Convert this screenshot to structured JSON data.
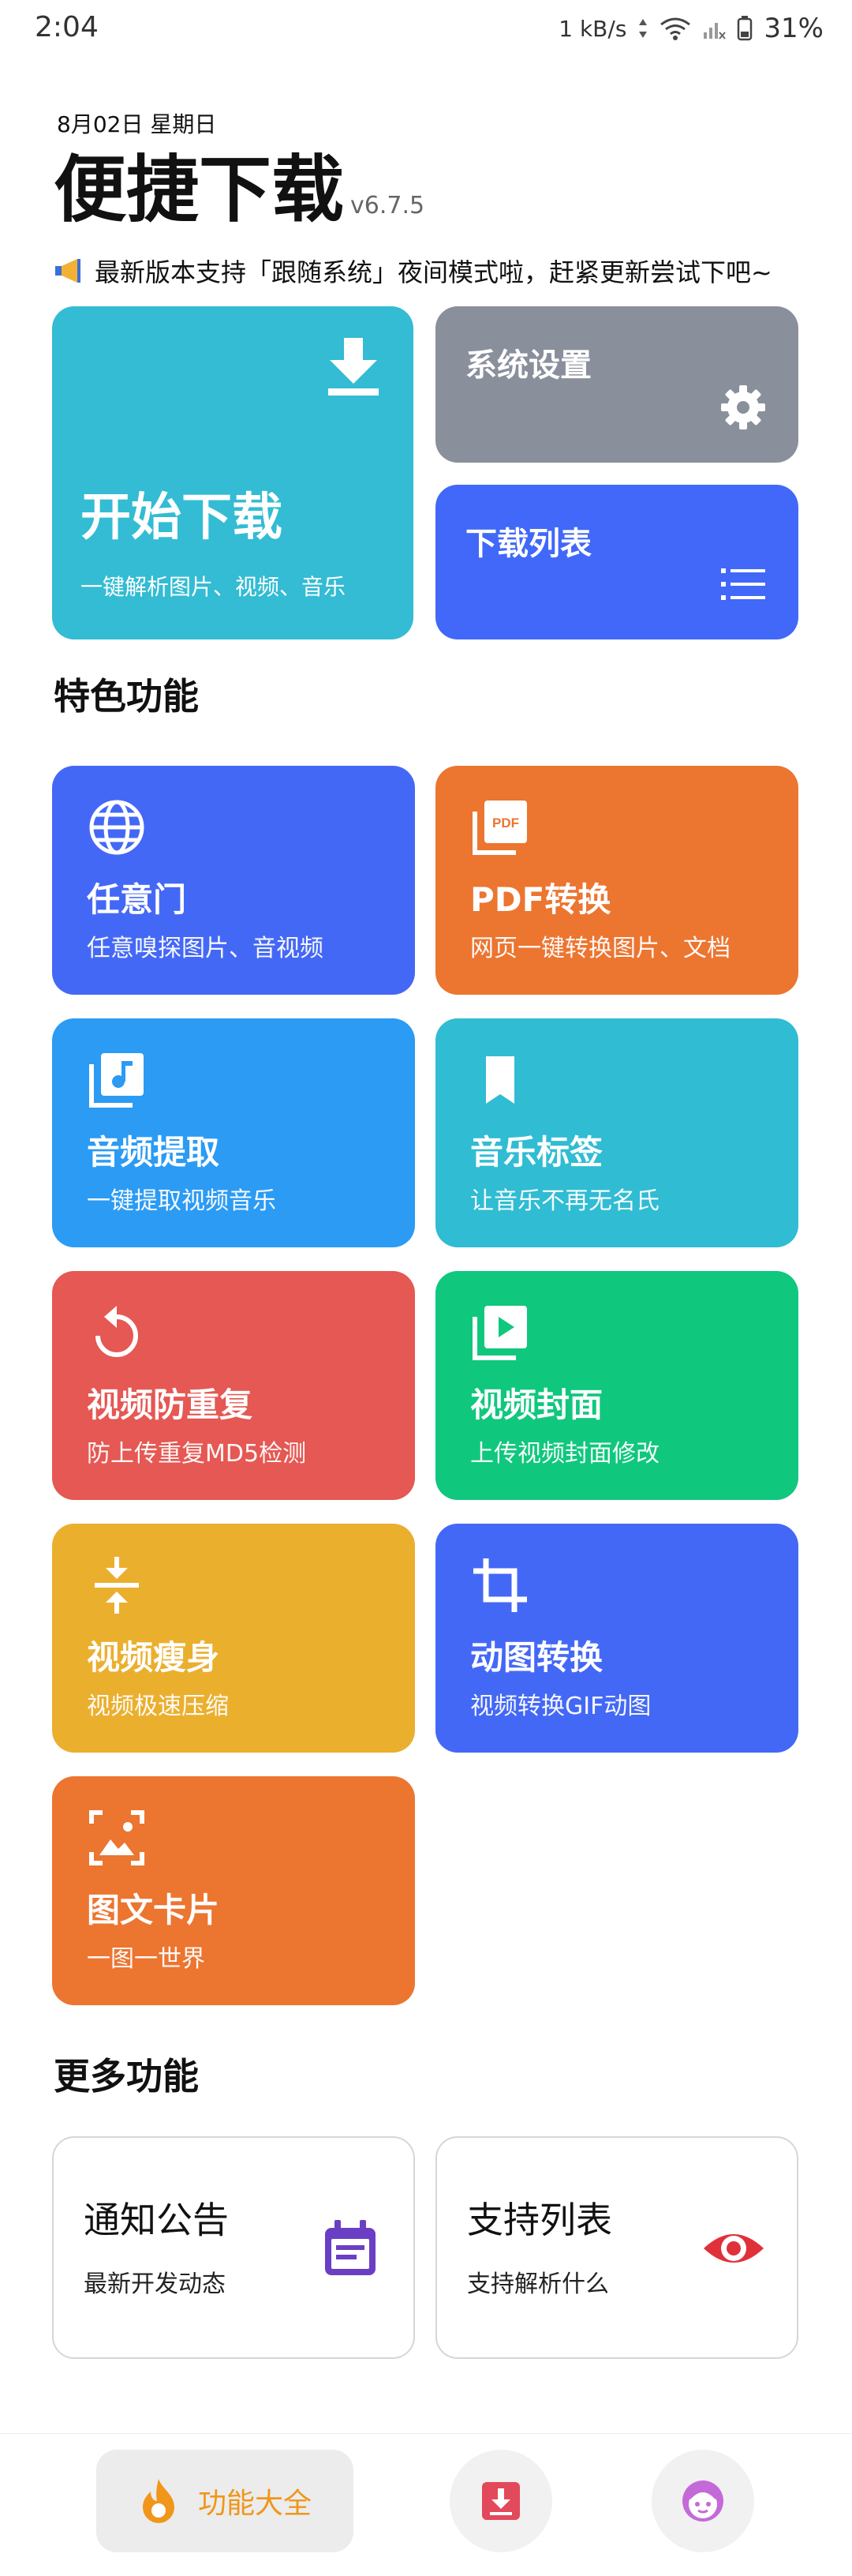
{
  "status_bar": {
    "time": "2:04",
    "speed": "1 kB/s",
    "battery": "31%"
  },
  "header": {
    "date": "8月02日 星期日",
    "title": "便捷下载",
    "version": "v6.7.5",
    "notice": "最新版本支持「跟随系统」夜间模式啦，赶紧更新尝试下吧~"
  },
  "main_tiles": {
    "start": {
      "title": "开始下载",
      "subtitle": "一键解析图片、视频、音乐",
      "icon": "download-icon"
    },
    "settings": {
      "title": "系统设置",
      "icon": "gear-icon"
    },
    "list": {
      "title": "下载列表",
      "icon": "list-icon"
    }
  },
  "features": {
    "section_title": "特色功能",
    "items": [
      {
        "title": "任意门",
        "subtitle": "任意嗅探图片、音视频",
        "icon": "globe-icon",
        "color": "#4468F6"
      },
      {
        "title": "PDF转换",
        "subtitle": "网页一键转换图片、文档",
        "icon": "pdf-icon",
        "color": "#EC7530"
      },
      {
        "title": "音频提取",
        "subtitle": "一键提取视频音乐",
        "icon": "music-library-icon",
        "color": "#2B9BF4"
      },
      {
        "title": "音乐标签",
        "subtitle": "让音乐不再无名氏",
        "icon": "bookmark-icon",
        "color": "#30BCD3"
      },
      {
        "title": "视频防重复",
        "subtitle": "防上传重复MD5检测",
        "icon": "replay-icon",
        "color": "#E55853"
      },
      {
        "title": "视频封面",
        "subtitle": "上传视频封面修改",
        "icon": "video-library-icon",
        "color": "#10C77E"
      },
      {
        "title": "视频瘦身",
        "subtitle": "视频极速压缩",
        "icon": "compress-icon",
        "color": "#EBAF2E"
      },
      {
        "title": "动图转换",
        "subtitle": "视频转换GIF动图",
        "icon": "crop-icon",
        "color": "#4468F6"
      },
      {
        "title": "图文卡片",
        "subtitle": "一图一世界",
        "icon": "image-card-icon",
        "color": "#EC7530"
      }
    ]
  },
  "more": {
    "section_title": "更多功能",
    "items": [
      {
        "title": "通知公告",
        "subtitle": "最新开发动态",
        "icon": "calendar-note-icon"
      },
      {
        "title": "支持列表",
        "subtitle": "支持解析什么",
        "icon": "eye-icon"
      }
    ]
  },
  "bottom_nav": {
    "active_label": "功能大全",
    "items": [
      "flame-icon",
      "download-box-icon",
      "face-icon"
    ]
  },
  "colors": {
    "start": "#33BCD3",
    "settings": "#8A8F9C",
    "list": "#4168F8",
    "nav_active": "#F0961A",
    "calendar_icon": "#6B3FC4",
    "eye_icon": "#E0313A"
  }
}
